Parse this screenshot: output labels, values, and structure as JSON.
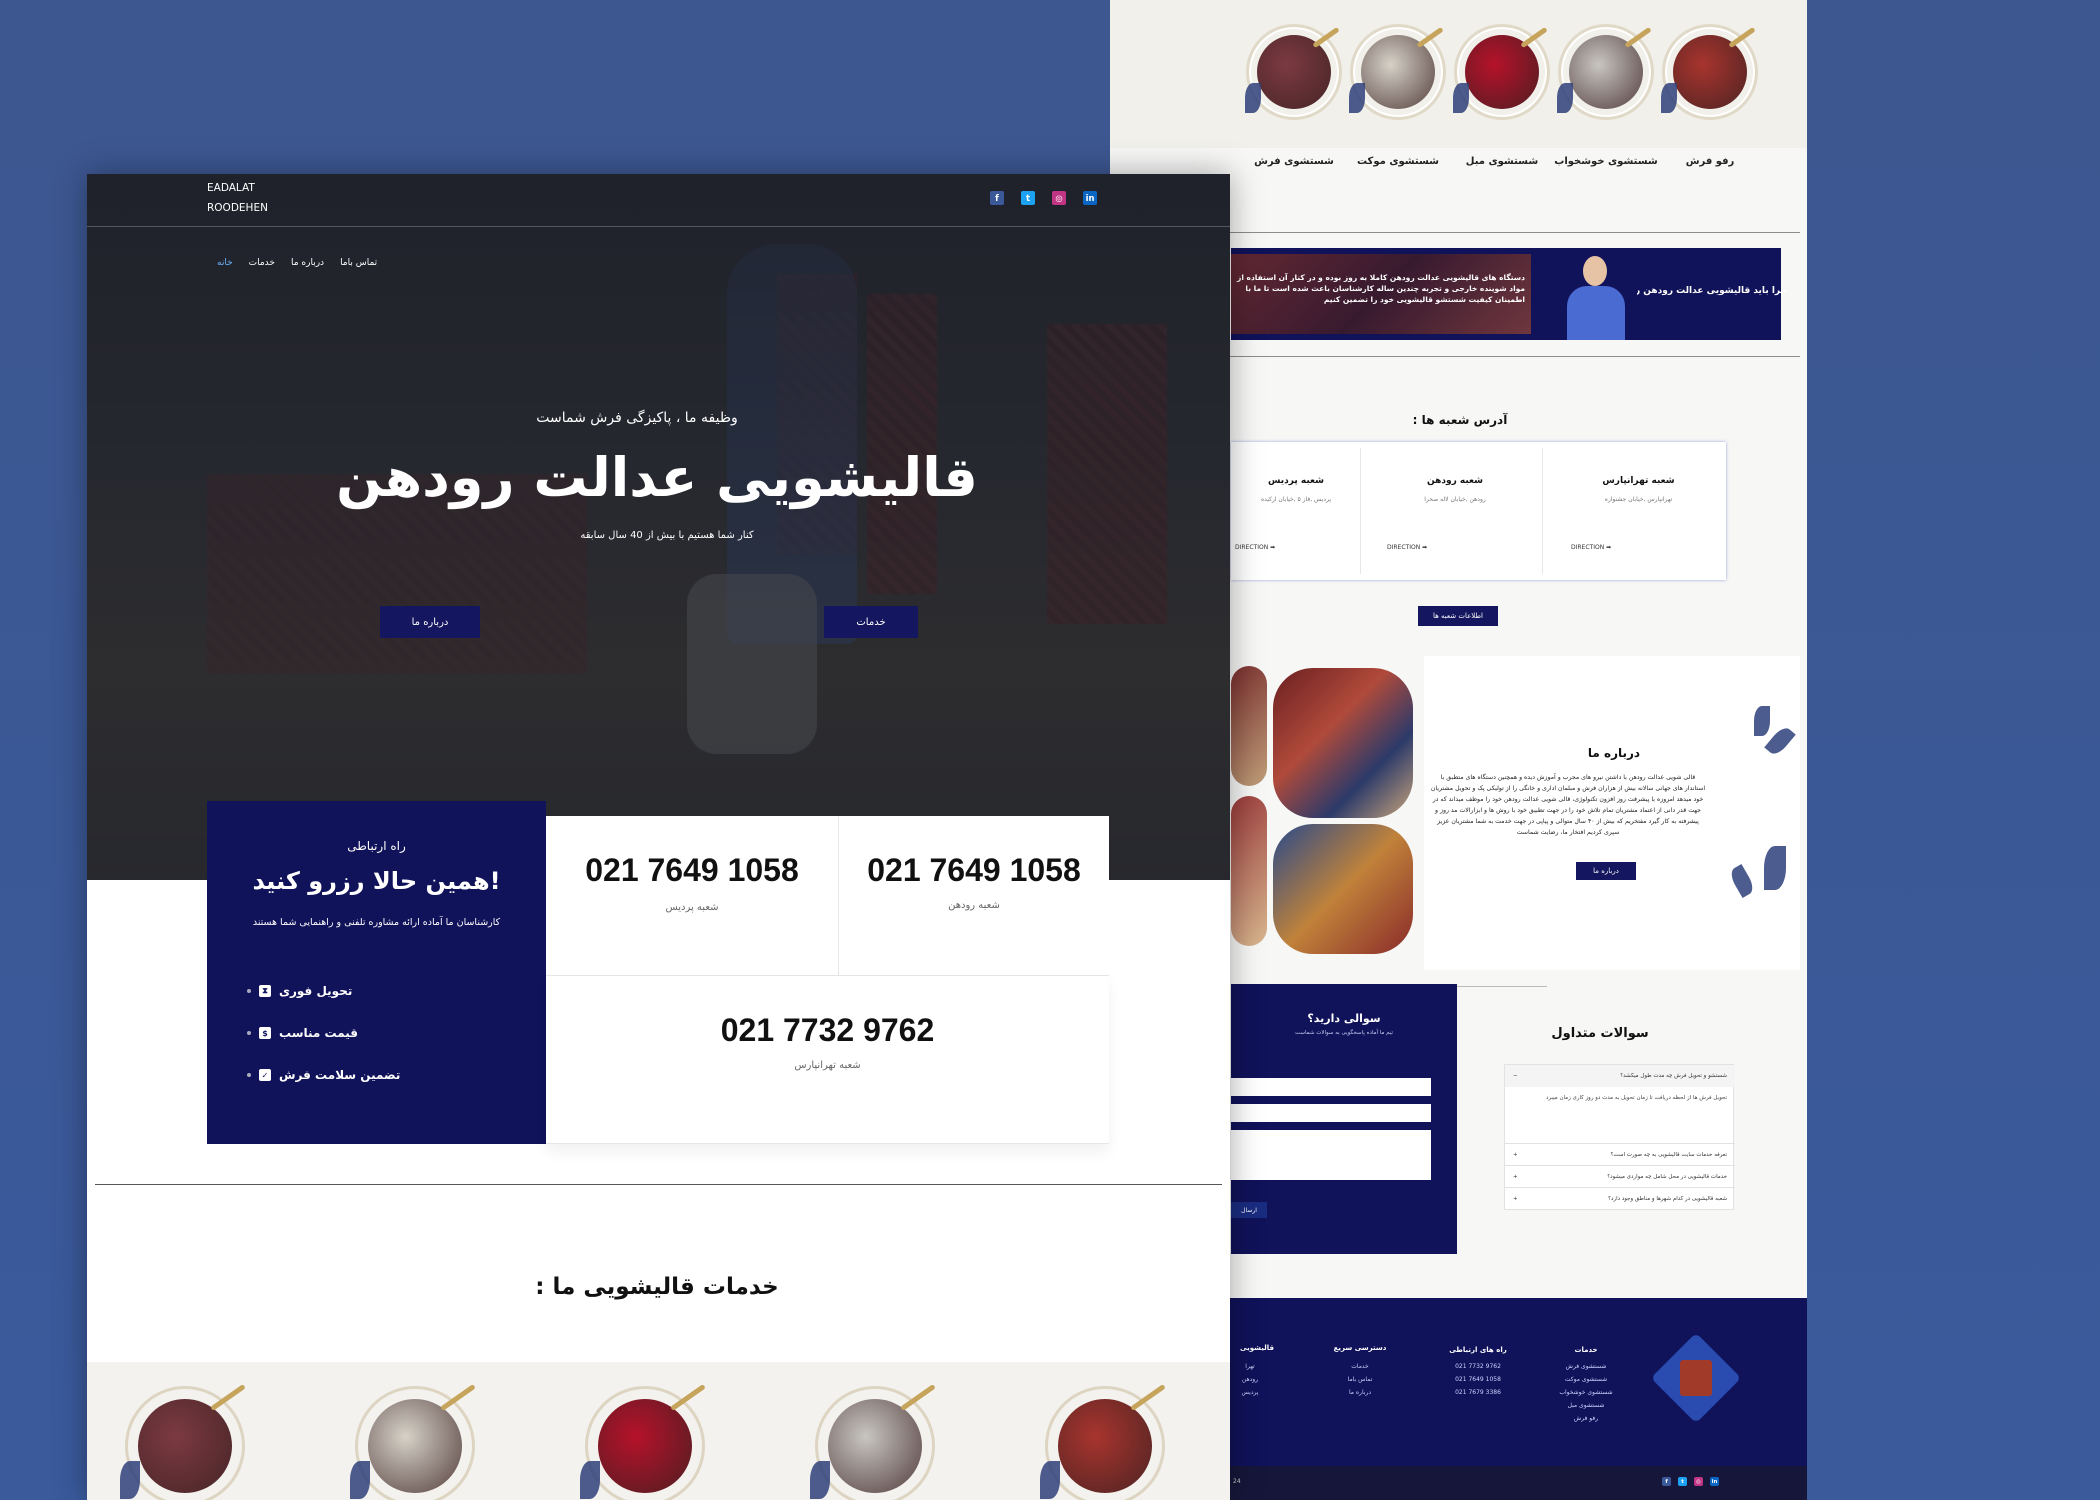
{
  "colors": {
    "navy": "#10125a",
    "page_bg": "#3b5896",
    "facebook": "#3b5998",
    "twitter": "#1da1f2",
    "instagram": "#c13584",
    "linkedin": "#0a66c2",
    "accent_nav": "#6fb7ff"
  },
  "brand": {
    "line1": "EADALAT",
    "line2": "ROODEHEN"
  },
  "social": [
    {
      "icon": "facebook-icon",
      "glyph": "f"
    },
    {
      "icon": "twitter-icon",
      "glyph": "t"
    },
    {
      "icon": "instagram-icon",
      "glyph": "◎"
    },
    {
      "icon": "linkedin-icon",
      "glyph": "in"
    }
  ],
  "nav": {
    "home": "خانه",
    "services": "خدمات",
    "about": "درباره ما",
    "contact": "تماس باما"
  },
  "hero": {
    "tagline": "وظیفه ما ، پاکیزگی فرش شماست",
    "title": "قالیشویی عدالت رودهن",
    "subtitle": "کنار شما هستیم با بیش از 40 سال سابقه",
    "btn_about": "درباره ما",
    "btn_services": "خدمات"
  },
  "contact": {
    "kicker": "راه ارتباطی",
    "heading": "همین حالا رزرو کنید!",
    "desc": "کارشناسان ما آماده ارائه مشاوره تلفنی و راهنمایی شما هستند",
    "features": [
      {
        "label": "تحویل فوری",
        "icon": "hourglass-icon",
        "glyph": "⧗"
      },
      {
        "label": "قیمت مناسب",
        "icon": "price-tag-icon",
        "glyph": "$"
      },
      {
        "label": "تضمین سلامت فرش",
        "icon": "check-circle-icon",
        "glyph": "✓"
      }
    ]
  },
  "phones": [
    {
      "number": "021 7649 1058",
      "branch": "شعبه پردیس"
    },
    {
      "number": "021 7649 1058",
      "branch": "شعبه رودهن"
    },
    {
      "number": "021 7732 9762",
      "branch": "شعبه تهرانپارس"
    }
  ],
  "services_heading": "خدمات قالیشویی ما :",
  "services": [
    {
      "label": "رفو فرش",
      "color": "#a8342e"
    },
    {
      "label": "شستشوی خوشخواب",
      "color": "#c8c6c2"
    },
    {
      "label": "شستشوی مبل",
      "color": "#b5122a"
    },
    {
      "label": "شستشوی موکت",
      "color": "#d6d2c8"
    },
    {
      "label": "شستشوی فرش",
      "color": "#7c3a42"
    }
  ],
  "why": {
    "title": "چرا باید قالیشویی عدالت رودهن را",
    "text": "دستگاه های قالیشویی عدالت رودهن کاملا به روز بوده و در کنار آن استفاده از مواد شوینده خارجی و تجربه چندین ساله کارشناسان باعث شده است تا ما با اطمینان کیفیت شستشو قالیشویی خود را تضمین کنیم"
  },
  "branches": {
    "heading": "آدرس شعبه ها :",
    "items": [
      {
        "title": "شعبه تهرانپارس",
        "addr": "تهرانپارس ,خیابان جشنواره",
        "dir": "DIRECTION ➡"
      },
      {
        "title": "شعبه رودهن",
        "addr": "رودهن ,خیابان لاله صحرا",
        "dir": "DIRECTION ➡"
      },
      {
        "title": "شعبه پردیس",
        "addr": "پردیس ,فاز ۵ ,خیابان ارکیده",
        "dir": "DIRECTION ➡"
      }
    ],
    "info_btn": "اطلاعات شعبه ها"
  },
  "about": {
    "title": "درباره ما",
    "text": "قالی شویی عدالت رودهن با داشتن نیرو های مجرب و آموزش دیده و همچنین دستگاه های متطبق با استاندار های جهانی سالانه بیش از هزاران فرش و مبلمان اداری و خانگی را از تولیکی پک و تحویل مشتریان خود میدهد امروزه با پیشرفت روز افزون تکنولوژی، قالی شویی عدالت رودهن خود را موظف میداند که در جهت قدر دانی از اعتماد مشتریان تمام تلاش خود را در جهت تطبیق خود با روش ها و ابزارالات مد روز و پیشرفته به کار گیرد مفتخریم که بیش از ۴۰ سال متوالی و پیاپی در جهت خدمت به شما مشتریان عزیز سپری کردیم افتخار ما، رضایت شماست",
    "btn": "درباره ما"
  },
  "question": {
    "title": "سوالی دارید؟",
    "sub": "تیم ما آماده پاسخگویی به سوالات شماست",
    "send": "ارسال"
  },
  "faq": {
    "heading": "سوالات متداول",
    "open_q": "شستشو و تحویل فرش چه مدت طول میکشد؟",
    "open_a": "تحویل فرش ها از لحظه دریافت تا زمان تحویل به مدت دو روز کاری زمان میبرد",
    "items": [
      "تعرفه خدمات سایت قالیشویی به چه صورت است؟",
      "خدمات قالیشویی در محل شامل چه مواردی میشود؟",
      "شعبه قالیشویی در کدام شهرها و مناطق وجود دارد؟"
    ]
  },
  "footer": {
    "services_h": "خدمات",
    "services": [
      "شستشوی فرش",
      "شستشوی موکت",
      "شستشوی خوشخواب",
      "شستشوی مبل",
      "رفو فرش"
    ],
    "contact_h": "راه های ارتباطی",
    "contact": [
      "021 7732 9762",
      "021 7649 1058",
      "021 7679 3386"
    ],
    "quick_h": "دسترسی سریع",
    "quick": [
      "خدمات",
      "تماس باما",
      "درباره ما"
    ],
    "branches_h": "قالیشویی",
    "branches": [
      "تهرا",
      "رودهن",
      "پردیس"
    ],
    "year": "24"
  }
}
